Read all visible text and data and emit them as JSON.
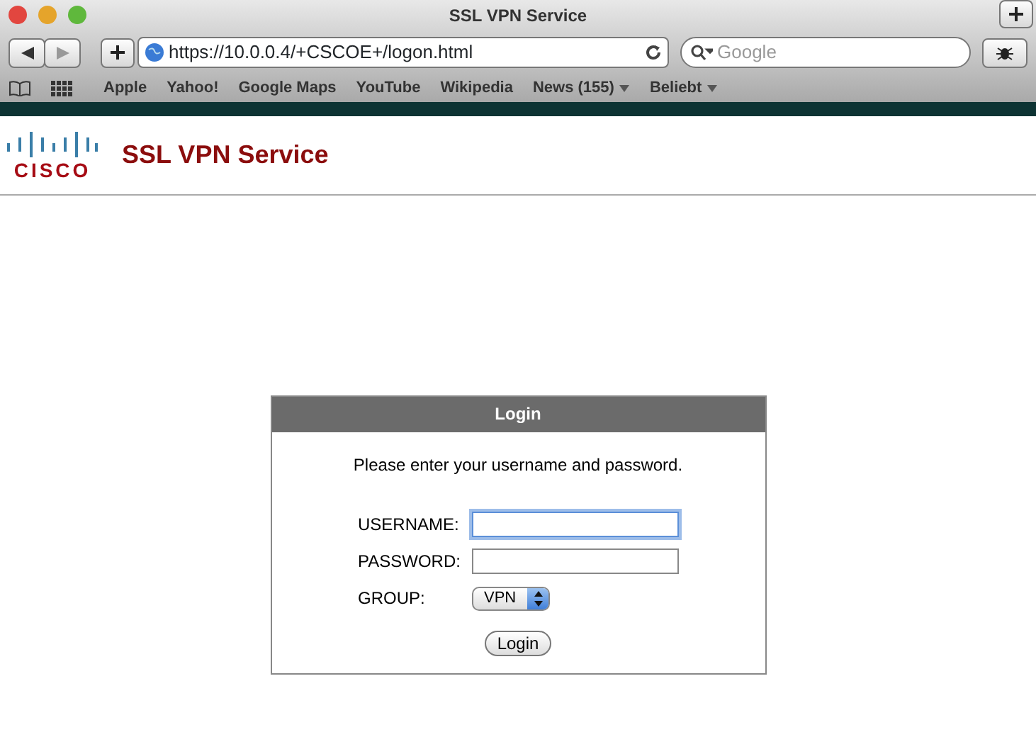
{
  "window": {
    "title": "SSL VPN Service"
  },
  "toolbar": {
    "address": "https://10.0.0.4/+CSCOE+/logon.html",
    "search_placeholder": "Google"
  },
  "bookmarks": [
    {
      "label": "Apple",
      "menu": false
    },
    {
      "label": "Yahoo!",
      "menu": false
    },
    {
      "label": "Google Maps",
      "menu": false
    },
    {
      "label": "YouTube",
      "menu": false
    },
    {
      "label": "Wikipedia",
      "menu": false
    },
    {
      "label": "News (155)",
      "menu": true
    },
    {
      "label": "Beliebt",
      "menu": true
    }
  ],
  "header": {
    "logo_text": "CISCO",
    "title": "SSL VPN Service"
  },
  "login": {
    "title": "Login",
    "prompt": "Please enter your username and password.",
    "fields": [
      {
        "label": "USERNAME:",
        "kind": "text",
        "focused": true
      },
      {
        "label": "PASSWORD:",
        "kind": "password",
        "focused": false
      },
      {
        "label": "GROUP:",
        "kind": "select",
        "value": "VPN"
      }
    ],
    "button": "Login"
  }
}
